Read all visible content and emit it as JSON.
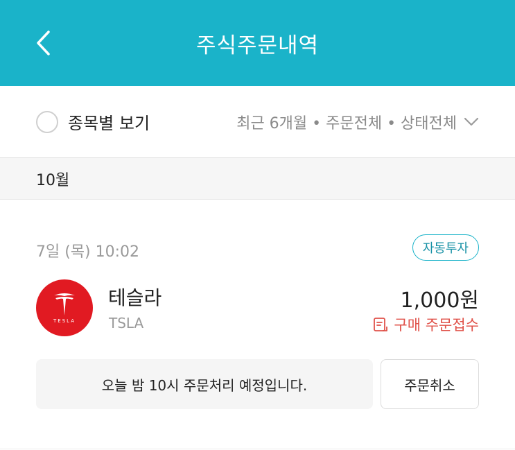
{
  "header": {
    "title": "주식주문내역",
    "back_icon": "chevron-left-icon"
  },
  "filters": {
    "group_by_label": "종목별 보기",
    "summary": "최근 6개월 • 주문전체 • 상태전체",
    "dropdown_icon": "chevron-down-icon"
  },
  "month": {
    "label": "10월"
  },
  "order": {
    "date": "7일 (목) 10:02",
    "badge": "자동투자",
    "stock_name": "테슬라",
    "ticker": "TSLA",
    "logo_text": "TESLA",
    "amount": "1,000원",
    "status": "구매 주문접수",
    "notice": "오늘 밤 10시 주문처리 예정입니다.",
    "cancel_label": "주문취소"
  },
  "colors": {
    "brand": "#1ab3c9",
    "status_red": "#e0524a",
    "tesla_red": "#e11a22"
  }
}
